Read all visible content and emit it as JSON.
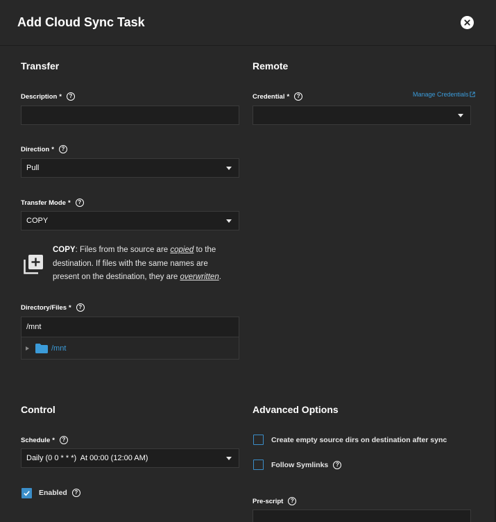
{
  "dialog": {
    "title": "Add Cloud Sync Task",
    "close_icon": "close-icon"
  },
  "transfer": {
    "title": "Transfer",
    "description": {
      "label": "Description",
      "required": "*",
      "value": ""
    },
    "direction": {
      "label": "Direction",
      "required": "*",
      "value": "Pull"
    },
    "transfer_mode": {
      "label": "Transfer Mode",
      "required": "*",
      "value": "COPY"
    },
    "mode_info": {
      "icon": "library-add-icon",
      "mode": "COPY",
      "text_1": ": Files from the source are ",
      "em_1": "copied",
      "text_2": " to the destination. If files with the same names are present on the destination, they are ",
      "em_2": "overwritten",
      "text_3": "."
    },
    "directory": {
      "label": "Directory/Files",
      "required": "*",
      "value": "/mnt",
      "tree_node": "/mnt",
      "folder_icon": "folder-icon"
    }
  },
  "remote": {
    "title": "Remote",
    "credential": {
      "label": "Credential",
      "required": "*",
      "value": ""
    },
    "manage_link": "Manage Credentials",
    "link_icon": "open-in-new-icon"
  },
  "control": {
    "title": "Control",
    "schedule": {
      "label": "Schedule",
      "required": "*",
      "value": "Daily (0 0 * * *)  At 00:00 (12:00 AM)"
    },
    "enabled": {
      "label": "Enabled",
      "checked": true
    }
  },
  "advanced": {
    "title": "Advanced Options",
    "create_empty_dirs": {
      "label": "Create empty source dirs on destination after sync",
      "checked": false
    },
    "follow_symlinks": {
      "label": "Follow Symlinks",
      "checked": false
    },
    "pre_script": {
      "label": "Pre-script"
    }
  },
  "colors": {
    "background": "#282828",
    "field_bg": "#1e1e1e",
    "accent": "#3b8ec9",
    "link": "#3b9bd9"
  }
}
